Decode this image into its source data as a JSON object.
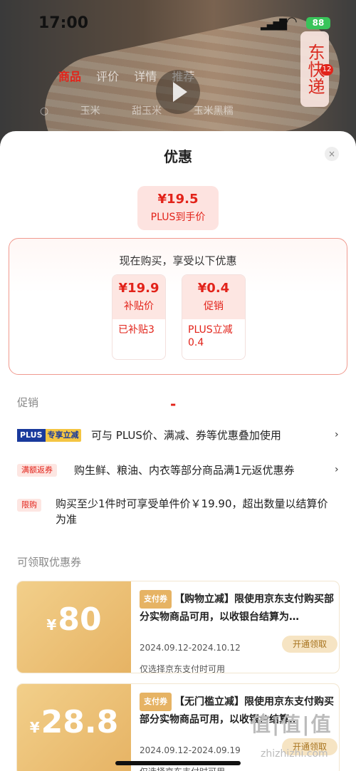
{
  "status": {
    "time": "17:00",
    "battery": "88"
  },
  "background": {
    "tabs": [
      "商品",
      "评价",
      "详情",
      "推荐"
    ],
    "express_badge": "东快递",
    "express_count": "12",
    "search_items": [
      "玉米",
      "甜玉米",
      "玉米黑糯"
    ]
  },
  "sheet": {
    "title": "优惠",
    "close_icon": "×",
    "final_price": {
      "amount": "¥19.5",
      "label": "PLUS到手价"
    },
    "promo_box": {
      "heading": "现在购买，享受以下优惠",
      "cards": [
        {
          "value": "¥19.9",
          "name": "补贴价",
          "detail": "已补贴3"
        },
        {
          "value": "¥0.4",
          "name": "促销",
          "detail": "PLUS立减0.4"
        }
      ],
      "operator": "-"
    },
    "promotions_label": "促销",
    "promotions": [
      {
        "tag_plus": "PLUS",
        "tag_rest": "专享立减",
        "text": "可与 PLUS价、满减、券等优惠叠加使用"
      },
      {
        "tag": "满额返券",
        "text": "购生鲜、粮油、内衣等部分商品满1元返优惠券"
      },
      {
        "tag": "限购",
        "text": "购买至少1件时可享受单件价￥19.90，超出数量以结算价为准"
      }
    ],
    "coupons_label": "可领取优惠券",
    "coupons": [
      {
        "currency": "¥",
        "amount": "80",
        "tag": "支付券",
        "title": "【购物立减】限使用京东支付购买部分实物商品可用，以收银台结算为…",
        "date": "2024.09.12-2024.10.12",
        "note": "仅选择京东支付时可用",
        "button": "开通领取"
      },
      {
        "currency": "¥",
        "amount": "28.8",
        "tag": "支付券",
        "title": "【无门槛立减】限使用京东支付购买部分实物商品可用，以收银台结算…",
        "date": "2024.09.12-2024.09.19",
        "note": "仅选择京东支付时可用",
        "button": "开通领取"
      }
    ]
  },
  "watermark": {
    "main": "值|值|值",
    "sub": "zhizhizhi.com"
  },
  "colors": {
    "accent": "#e2231a",
    "coupon_gold": "#e6b364",
    "plus_blue": "#1a3a9c"
  }
}
